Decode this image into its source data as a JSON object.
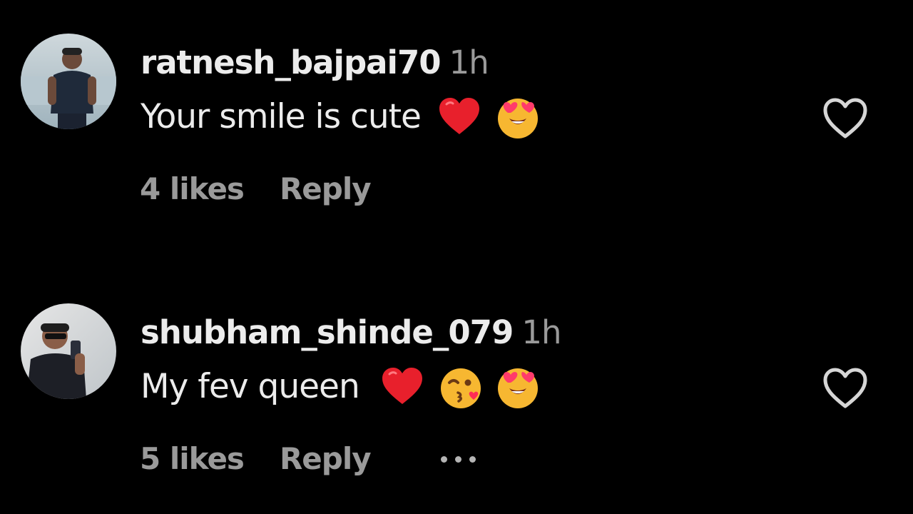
{
  "comments": [
    {
      "username": "ratnesh_bajpai70",
      "time": "1h",
      "text": "Your smile is cute",
      "emojis": [
        "red-heart-emoji",
        "heart-eyes-emoji"
      ],
      "likes": "4 likes",
      "reply": "Reply",
      "has_more_menu": false
    },
    {
      "username": "shubham_shinde_079",
      "time": "1h",
      "text": "My fev queen",
      "emojis": [
        "red-heart-emoji",
        "kiss-wink-emoji",
        "heart-eyes-emoji"
      ],
      "likes": "5 likes",
      "reply": "Reply",
      "has_more_menu": true
    }
  ],
  "colors": {
    "background": "#000000",
    "primary_text": "#ececec",
    "secondary_text": "#9a9a9a",
    "heart_red": "#e8202c",
    "emoji_yellow": "#f7b731"
  }
}
